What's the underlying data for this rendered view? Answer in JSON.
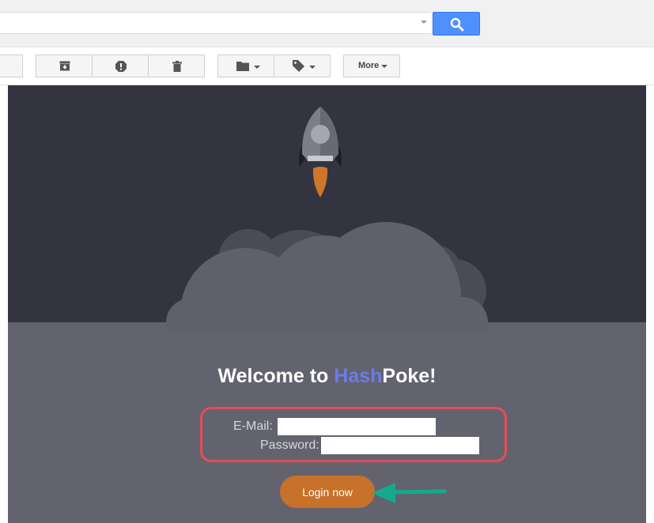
{
  "search": {
    "value": "",
    "placeholder": "",
    "button_icon": "search-icon"
  },
  "toolbar": {
    "buttons": [
      {
        "name": "archive-button",
        "icon": "archive-icon"
      },
      {
        "name": "report-spam-button",
        "icon": "report-spam-icon"
      },
      {
        "name": "delete-button",
        "icon": "trash-icon"
      },
      {
        "name": "move-to-button",
        "icon": "folder-icon"
      },
      {
        "name": "labels-button",
        "icon": "label-tag-icon"
      }
    ],
    "more_label": "More"
  },
  "email": {
    "welcome_prefix": "Welcome to ",
    "brand_part1": "Hash",
    "brand_part2": "Poke!",
    "email_label": "E-Mail:",
    "email_value": "",
    "password_label": "Password:",
    "password_value": "",
    "login_label": "Login now",
    "illustration": "rocket-icon"
  },
  "colors": {
    "search_button": "#4d90fe",
    "email_background_dark": "#333440",
    "email_background_light": "#62636f",
    "brand_accent": "#6b7ce8",
    "login_button": "#c8712a",
    "highlight_frame": "#e94b55",
    "annotation_arrow": "#15a98e"
  }
}
